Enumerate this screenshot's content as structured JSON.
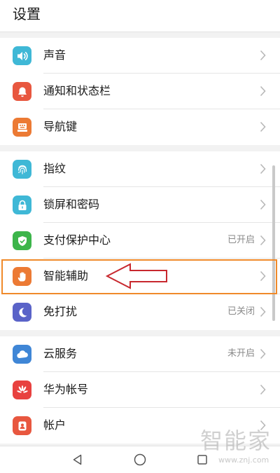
{
  "header": {
    "title": "设置"
  },
  "groups": [
    {
      "items": [
        {
          "label": "声音",
          "status": "",
          "icon": "volume-icon",
          "color": "#3fb8d6"
        },
        {
          "label": "通知和状态栏",
          "status": "",
          "icon": "bell-icon",
          "color": "#e8573f"
        },
        {
          "label": "导航键",
          "status": "",
          "icon": "keyboard-icon",
          "color": "#ec7a34"
        }
      ]
    },
    {
      "items": [
        {
          "label": "指纹",
          "status": "",
          "icon": "fingerprint-icon",
          "color": "#3fb8d6"
        },
        {
          "label": "锁屏和密码",
          "status": "",
          "icon": "lock-icon",
          "color": "#3fb8d6"
        },
        {
          "label": "支付保护中心",
          "status": "已开启",
          "icon": "shield-icon",
          "color": "#3cb54a"
        },
        {
          "label": "智能辅助",
          "status": "",
          "icon": "hand-icon",
          "color": "#ec7a34"
        },
        {
          "label": "免打扰",
          "status": "已关闭",
          "icon": "moon-icon",
          "color": "#5a63c8"
        }
      ]
    },
    {
      "items": [
        {
          "label": "云服务",
          "status": "未开启",
          "icon": "cloud-icon",
          "color": "#3f86d6"
        },
        {
          "label": "华为帐号",
          "status": "",
          "icon": "huawei-icon",
          "color": "#e8413f"
        },
        {
          "label": "帐户",
          "status": "",
          "icon": "account-icon",
          "color": "#e8573f"
        }
      ]
    }
  ],
  "highlight": {
    "color": "#f08a2a",
    "arrow_color": "#c8282e"
  },
  "watermark": {
    "big": "智能家",
    "small": "www.znj.com"
  },
  "navbar": {
    "items": [
      "back-icon",
      "home-icon",
      "recents-icon"
    ]
  }
}
